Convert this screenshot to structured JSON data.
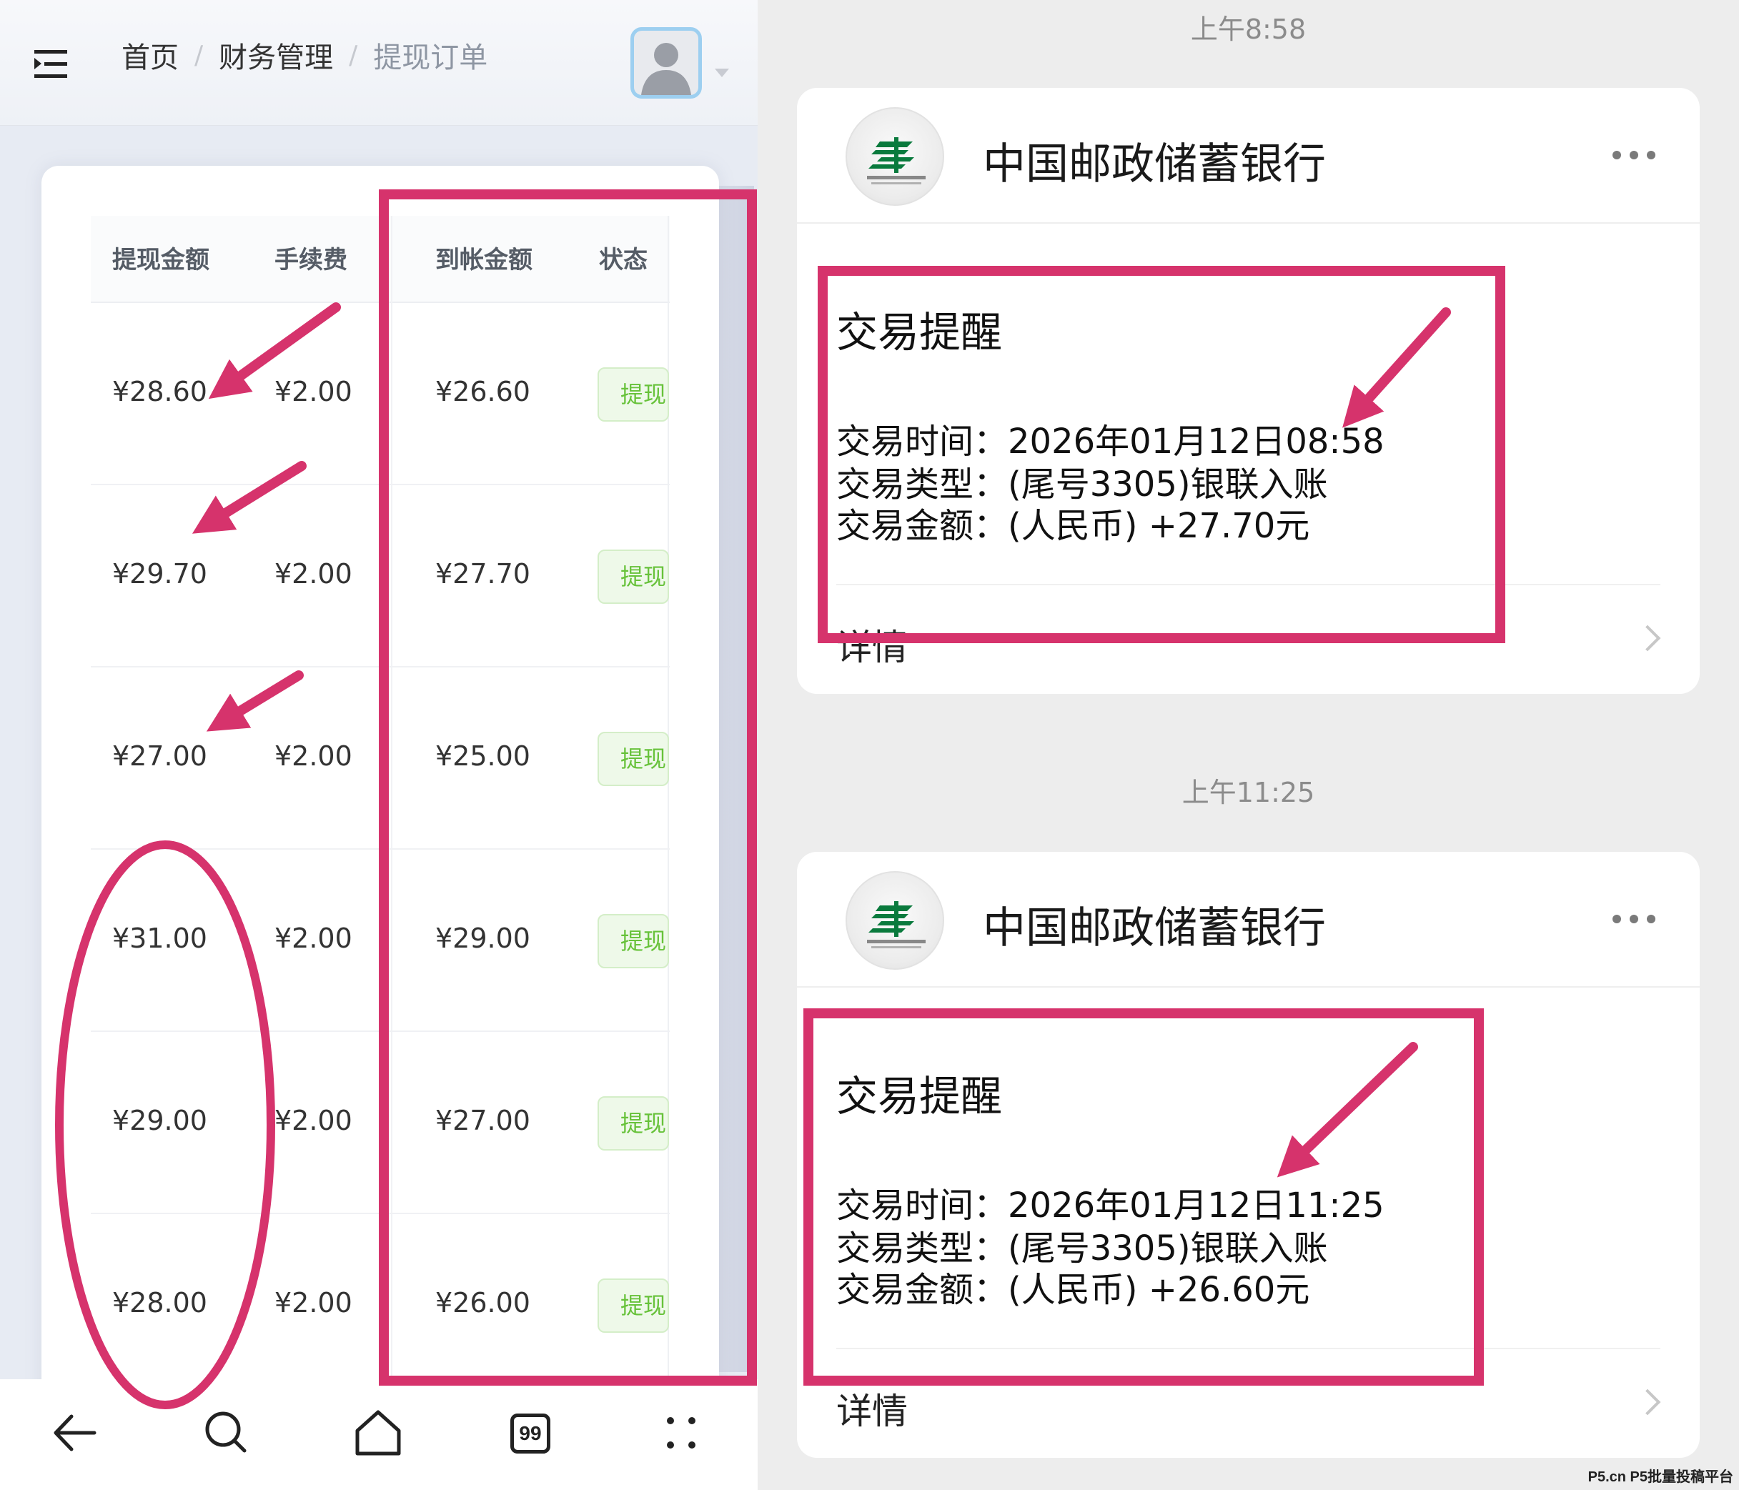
{
  "left": {
    "header": {
      "breadcrumb": [
        "首页",
        "财务管理",
        "提现订单"
      ],
      "separator": "/"
    },
    "table": {
      "columns": [
        "提现金额",
        "手续费",
        "到帐金额",
        "状态"
      ],
      "rows": [
        {
          "amount": "¥28.60",
          "fee": "¥2.00",
          "received": "¥26.60",
          "status": "提现"
        },
        {
          "amount": "¥29.70",
          "fee": "¥2.00",
          "received": "¥27.70",
          "status": "提现"
        },
        {
          "amount": "¥27.00",
          "fee": "¥2.00",
          "received": "¥25.00",
          "status": "提现"
        },
        {
          "amount": "¥31.00",
          "fee": "¥2.00",
          "received": "¥29.00",
          "status": "提现"
        },
        {
          "amount": "¥29.00",
          "fee": "¥2.00",
          "received": "¥27.00",
          "status": "提现"
        },
        {
          "amount": "¥28.00",
          "fee": "¥2.00",
          "received": "¥26.00",
          "status": "提现"
        }
      ]
    },
    "navbar": {
      "tabs_count": "99"
    }
  },
  "right": {
    "messages": [
      {
        "timestamp": "上午8:58",
        "bank": "中国邮政储蓄银行",
        "title": "交易提醒",
        "time_line": "交易时间：2026年01月12日08:58",
        "type_line": "交易类型：(尾号3305)银联入账",
        "amount_line": "交易金额：(人民币) +27.70元",
        "detail": "详情"
      },
      {
        "timestamp": "上午11:25",
        "bank": "中国邮政储蓄银行",
        "title": "交易提醒",
        "time_line": "交易时间：2026年01月12日11:25",
        "type_line": "交易类型：(尾号3305)银联入账",
        "amount_line": "交易金额：(人民币) +26.60元",
        "detail": "详情"
      }
    ],
    "watermark": "P5.cn P5批量投稿平台"
  },
  "colors": {
    "annotation": "#d6336c",
    "status_green": "#67c23a",
    "bank_green": "#0a7a3d"
  }
}
